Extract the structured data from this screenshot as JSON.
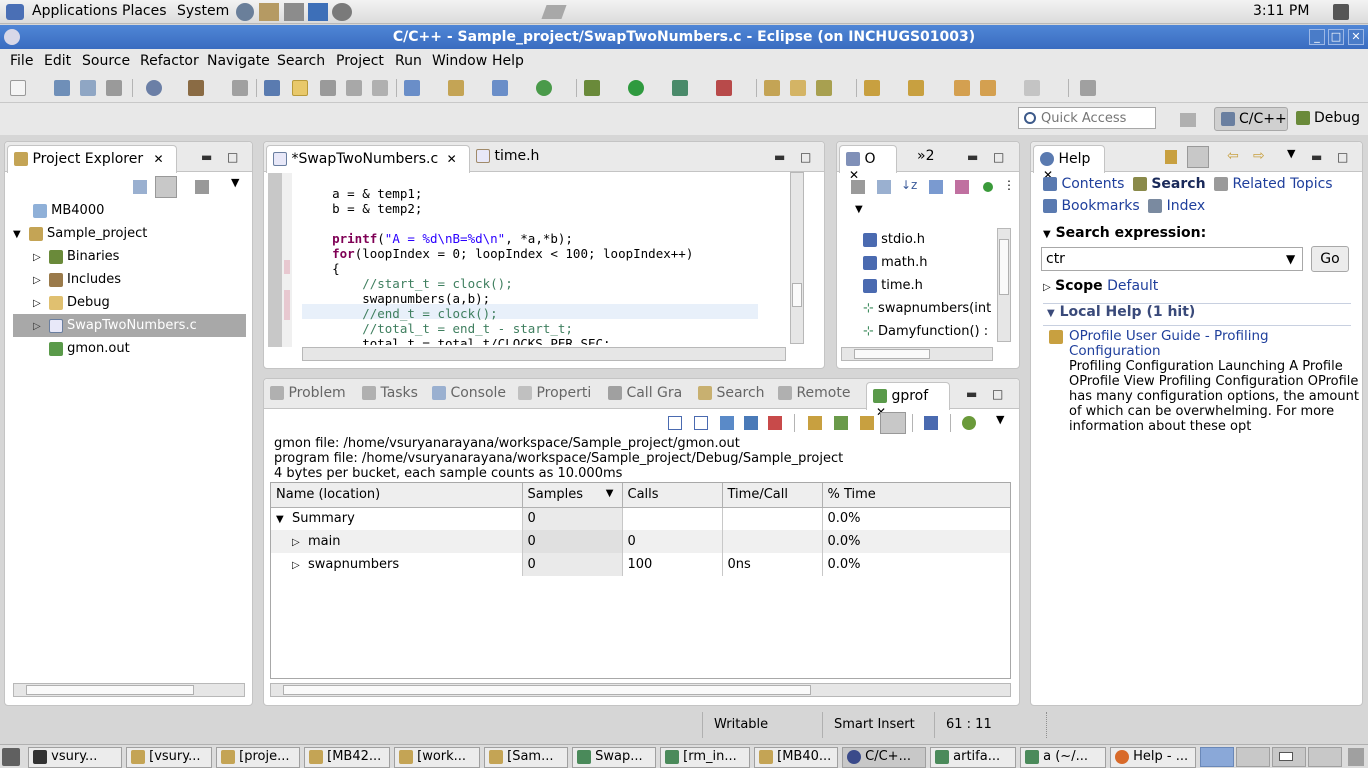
{
  "gnome_panel": {
    "menus": [
      "Applications",
      "Places",
      "System"
    ],
    "clock": "3:11 PM"
  },
  "window": {
    "title": "C/C++ - Sample_project/SwapTwoNumbers.c - Eclipse  (on INCHUGS01003)"
  },
  "menubar": [
    "File",
    "Edit",
    "Source",
    "Refactor",
    "Navigate",
    "Search",
    "Project",
    "Run",
    "Window",
    "Help"
  ],
  "quick_access": {
    "placeholder": "Quick Access",
    "perspectives": [
      "C/C++",
      "Debug"
    ]
  },
  "project_explorer": {
    "title": "Project Explorer",
    "items": [
      {
        "label": "MB4000",
        "level": 0,
        "icon": "folder-icon"
      },
      {
        "label": "Sample_project",
        "level": 0,
        "icon": "project-icon",
        "expanded": true
      },
      {
        "label": "Binaries",
        "level": 1,
        "icon": "binaries-icon"
      },
      {
        "label": "Includes",
        "level": 1,
        "icon": "includes-icon"
      },
      {
        "label": "Debug",
        "level": 1,
        "icon": "folder-icon"
      },
      {
        "label": "SwapTwoNumbers.c",
        "level": 1,
        "icon": "c-file-icon",
        "selected": true
      },
      {
        "label": "gmon.out",
        "level": 1,
        "icon": "gmon-file-icon"
      }
    ]
  },
  "editor": {
    "tabs": [
      "*SwapTwoNumbers.c",
      "time.h"
    ],
    "lines": [
      "    a = & temp1;",
      "    b = & temp2;",
      "",
      "    printf(\"A = %d\\nB=%d\\n\", *a,*b);",
      "    for(loopIndex = 0; loopIndex < 100; loopIndex++)",
      "    {",
      "        //start_t = clock();",
      "        swapnumbers(a,b);",
      "        //end_t = clock();",
      "        //total_t = end_t - start_t;",
      "        total_t = total_t/CLOCKS_PER_SEC;",
      "    }"
    ]
  },
  "outline": {
    "tabs": [
      "O",
      "»2"
    ],
    "items": [
      "stdio.h",
      "math.h",
      "time.h",
      "swapnumbers(int",
      "Damyfunction() :"
    ]
  },
  "help": {
    "title": "Help",
    "nav": [
      "Contents",
      "Search",
      "Related Topics",
      "Bookmarks",
      "Index"
    ],
    "search_expression_label": "Search expression:",
    "search_value": "ctr",
    "go_label": "Go",
    "scope_label": "Scope",
    "scope_value": "Default",
    "local_help": "Local Help (1 hit)",
    "result_title": "OProfile User Guide - Profiling Configuration",
    "result_text": "Profiling Configuration Launching A Profile OProfile View Profiling Configuration OProfile has many configuration options, the amount of which can be overwhelming. For more information about these opt"
  },
  "bottom_panel": {
    "tabs": [
      "Problem",
      "Tasks",
      "Console",
      "Properti",
      "Call Gra",
      "Search",
      "Remote",
      "gprof"
    ],
    "gmon_file": "gmon file: /home/vsuryanarayana/workspace/Sample_project/gmon.out",
    "program_file": "program file: /home/vsuryanarayana/workspace/Sample_project/Debug/Sample_project",
    "bucket_info": "4 bytes per bucket, each sample counts as 10.000ms",
    "columns": [
      "Name (location)",
      "Samples",
      "Calls",
      "Time/Call",
      "% Time"
    ],
    "rows": [
      {
        "name": "Summary",
        "samples": "0",
        "calls": "",
        "time_call": "",
        "pct": "0.0%"
      },
      {
        "name": "main",
        "samples": "0",
        "calls": "0",
        "time_call": "",
        "pct": "0.0%"
      },
      {
        "name": "swapnumbers",
        "samples": "0",
        "calls": "100",
        "time_call": "0ns",
        "pct": "0.0%"
      }
    ]
  },
  "status_bar": {
    "writable": "Writable",
    "insert_mode": "Smart Insert",
    "position": "61 : 11"
  },
  "taskbar": [
    "vsury...",
    "[vsury...",
    "[proje...",
    "[MB42...",
    "[work...",
    "[Sam...",
    "Swap...",
    "[rm_in...",
    "[MB40...",
    "C/C+...",
    "artifa...",
    "a (~/...",
    "Help - ..."
  ]
}
